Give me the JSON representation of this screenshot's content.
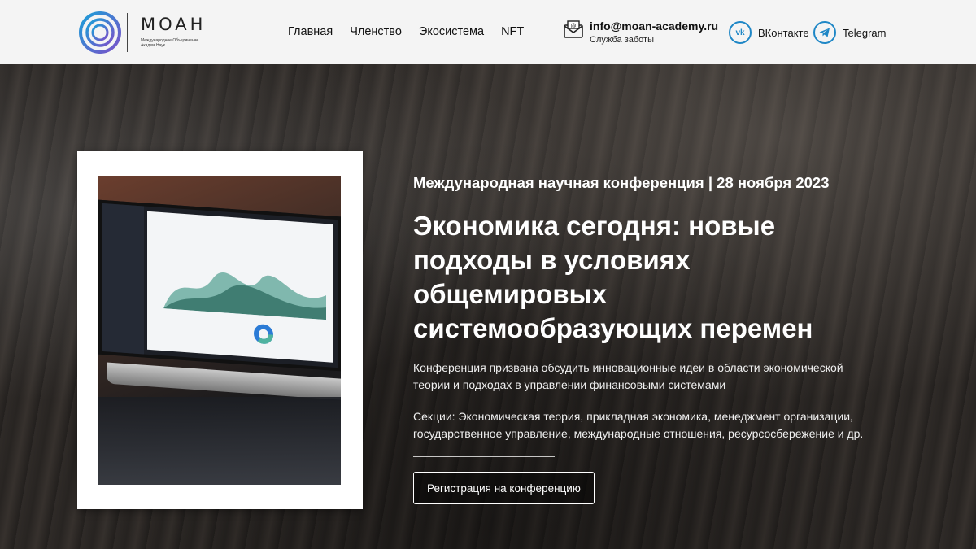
{
  "header": {
    "logo_word": "MOAH",
    "logo_sub": "Международное Объединение Академ Наук",
    "nav": [
      "Главная",
      "Членство",
      "Экосистема",
      "NFT"
    ],
    "email": "info@moan-academy.ru",
    "support_label": "Служба заботы",
    "vk_label": "ВКонтакте",
    "vk_icon_text": "vk",
    "telegram_label": "Telegram"
  },
  "hero": {
    "eyebrow": "Международная научная конференция | 28 ноября 2023",
    "headline": "Экономика сегодня: новые подходы в условиях общемировых системообразующих перемен",
    "description": "Конференция призвана обсудить инновационные идеи в области экономической теории и подходах в управлении финансовыми системами",
    "sections": "Секции: Экономическая теория, прикладная экономика, менеджмент организации, государственное управление, международные отношения, ресурсосбережение и др.",
    "cta_label": "Регистрация на конференцию"
  },
  "colors": {
    "accent": "#1f87c6",
    "header_bg": "#f4f4f4"
  }
}
